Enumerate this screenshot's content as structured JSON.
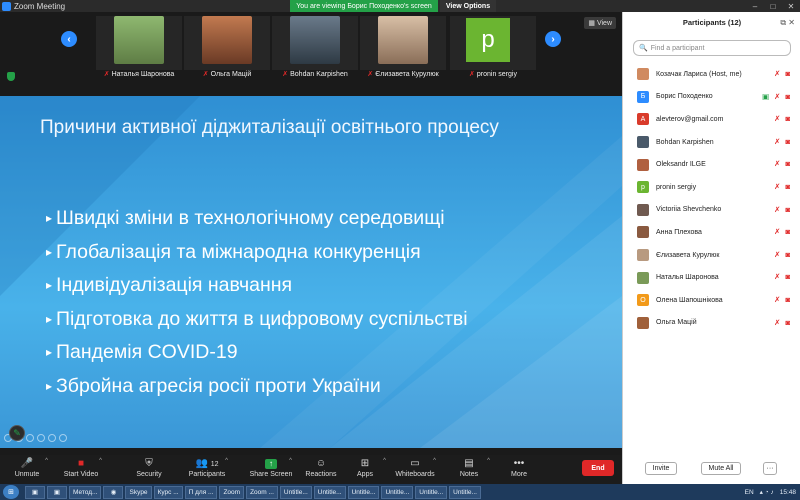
{
  "window": {
    "title": "Zoom Meeting",
    "viewing_banner": "You are viewing Борис Походенко's screen",
    "view_options": "View Options",
    "view_button": "View"
  },
  "video_strip": {
    "prev_icon": "chevron-left-icon",
    "next_icon": "chevron-right-icon",
    "tiles": [
      {
        "name": "Наталья Шаронова",
        "muted": true,
        "color": "#7a9a58"
      },
      {
        "name": "Ольга Мацій",
        "muted": true,
        "color": "#a0603a"
      },
      {
        "name": "Bohdan Karpishen",
        "muted": true,
        "color": "#4a5a6a"
      },
      {
        "name": "Єлизавета Курулюк",
        "muted": true,
        "color": "#b89a80"
      },
      {
        "name": "pronin sergiy",
        "muted": true,
        "letter": "p",
        "color": "#6bb531"
      }
    ]
  },
  "slide": {
    "title": "Причини активної діджиталізації освітнього процесу",
    "bullets": [
      "Швидкі зміни в технологічному середовищі",
      "Глобалізація та міжнародна конкуренція",
      "Індивідуалізація навчання",
      "Підготовка до життя в цифровому суспільстві",
      "Пандемія COVID-19",
      "Збройна агресія росії проти України"
    ]
  },
  "toolbar": {
    "unmute": "Unmute",
    "start_video": "Start Video",
    "security": "Security",
    "participants": "Participants",
    "participants_count": "12",
    "share_screen": "Share Screen",
    "reactions": "Reactions",
    "apps": "Apps",
    "whiteboards": "Whiteboards",
    "notes": "Notes",
    "more": "More",
    "end": "End"
  },
  "panel": {
    "title": "Participants (12)",
    "search_placeholder": "Find a participant",
    "invite": "Invite",
    "mute_all": "Mute All",
    "more": "···",
    "participants": [
      {
        "name": "Козачак Лариса (Host, me)",
        "avatar": "photo",
        "color": "#d08a60"
      },
      {
        "name": "Борис Походенко",
        "avatar": "Б",
        "color": "#2d8cff",
        "sharing": true
      },
      {
        "name": "alevterov@gmail.com",
        "avatar": "A",
        "color": "#d93b2b"
      },
      {
        "name": "Bohdan Karpishen",
        "avatar": "photo",
        "color": "#4a5a6a"
      },
      {
        "name": "Oleksandr ILGE",
        "avatar": "photo",
        "color": "#b06040"
      },
      {
        "name": "pronin sergiy",
        "avatar": "p",
        "color": "#6bb531"
      },
      {
        "name": "Victoriia Shevchenko",
        "avatar": "photo",
        "color": "#705a50"
      },
      {
        "name": "Анна Плехова",
        "avatar": "photo",
        "color": "#8a5a40"
      },
      {
        "name": "Єлизавета Курулюк",
        "avatar": "photo",
        "color": "#b89a80"
      },
      {
        "name": "Наталья Шаронова",
        "avatar": "photo",
        "color": "#7a9a58"
      },
      {
        "name": "Олена Шапошнікова",
        "avatar": "О",
        "color": "#f29a1a"
      },
      {
        "name": "Ольга Мацій",
        "avatar": "photo",
        "color": "#a0603a"
      }
    ]
  },
  "taskbar": {
    "items": [
      "Метод...",
      "Skype",
      "Курс ...",
      "П для ...",
      "Zoom",
      "Zoom ...",
      "Untitle...",
      "Untitle...",
      "Untitle...",
      "Untitle...",
      "Untitle...",
      "Untitle..."
    ],
    "lang": "EN",
    "time": "15:48"
  }
}
